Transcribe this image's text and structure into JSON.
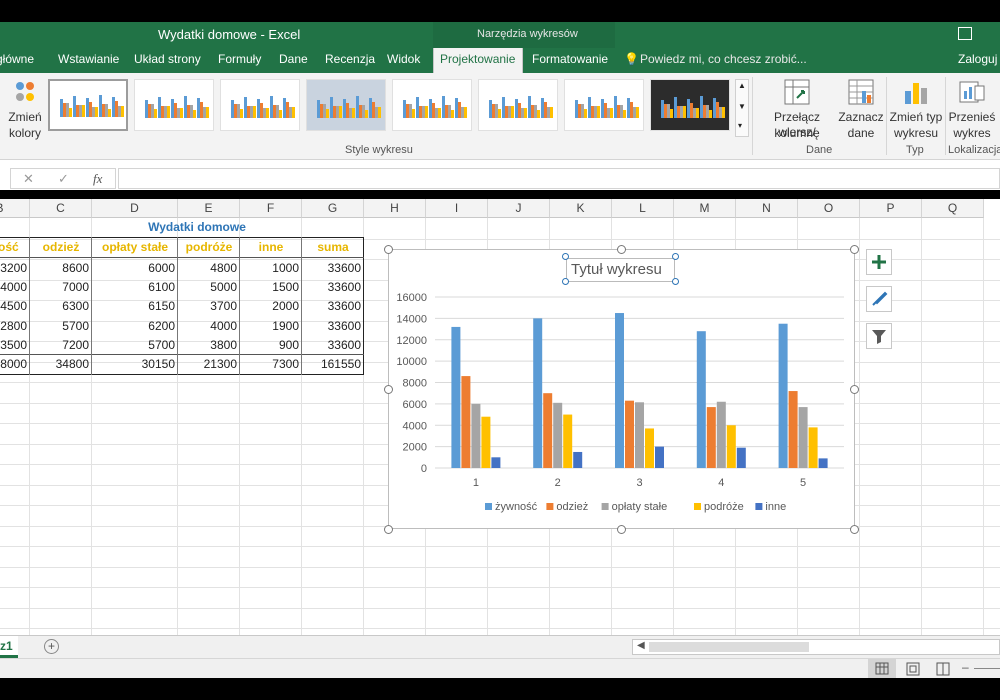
{
  "window": {
    "title": "Wydatki domowe - Excel",
    "context_title": "Narzędzia wykresów",
    "login": "Zaloguj"
  },
  "ribbon_tabs": [
    "główne",
    "Wstawianie",
    "Układ strony",
    "Formuły",
    "Dane",
    "Recenzja",
    "Widok",
    "Projektowanie",
    "Formatowanie"
  ],
  "active_tab": "Projektowanie",
  "tell_me": "Powiedz mi, co chcesz zrobić...",
  "ribbon": {
    "change_colors": [
      "Zmień",
      "kolory"
    ],
    "gallery_label": "Style wykresu",
    "switch_row_col": [
      "Przełącz wiersz/",
      "kolumnę"
    ],
    "select_data": [
      "Zaznacz",
      "dane"
    ],
    "data_group": "Dane",
    "change_type": [
      "Zmień typ",
      "wykresu"
    ],
    "type_group": "Typ",
    "move_chart": [
      "Przenieś",
      "wykres"
    ],
    "location_group": "Lokalizacja"
  },
  "formula_bar": {
    "cancel": "✕",
    "enter": "✓",
    "fx": "fx",
    "content": ""
  },
  "columns": [
    "B",
    "C",
    "D",
    "E",
    "F",
    "G",
    "H",
    "I",
    "J",
    "K",
    "L",
    "M",
    "N",
    "O",
    "P",
    "Q"
  ],
  "table": {
    "title": "Wydatki domowe",
    "headers": [
      "wność",
      "odzież",
      "opłaty stałe",
      "podróże",
      "inne",
      "suma"
    ],
    "rows": [
      [
        "3200",
        "8600",
        "6000",
        "4800",
        "1000",
        "33600"
      ],
      [
        "4000",
        "7000",
        "6100",
        "5000",
        "1500",
        "33600"
      ],
      [
        "4500",
        "6300",
        "6150",
        "3700",
        "2000",
        "33600"
      ],
      [
        "2800",
        "5700",
        "6200",
        "4000",
        "1900",
        "33600"
      ],
      [
        "3500",
        "7200",
        "5700",
        "3800",
        "900",
        "33600"
      ]
    ],
    "totals": [
      "8000",
      "34800",
      "30150",
      "21300",
      "7300",
      "161550"
    ]
  },
  "chart_data": {
    "type": "bar",
    "title": "Tytuł wykresu",
    "categories": [
      "1",
      "2",
      "3",
      "4",
      "5"
    ],
    "ylim": [
      0,
      16000
    ],
    "yticks": [
      0,
      2000,
      4000,
      6000,
      8000,
      10000,
      12000,
      14000,
      16000
    ],
    "grid": true,
    "legend": "bottom",
    "series": [
      {
        "name": "żywność",
        "color": "#5b9bd5",
        "values": [
          13200,
          14000,
          14500,
          12800,
          13500
        ]
      },
      {
        "name": "odzież",
        "color": "#ed7d31",
        "values": [
          8600,
          7000,
          6300,
          5700,
          7200
        ]
      },
      {
        "name": "opłaty stałe",
        "color": "#a5a5a5",
        "values": [
          6000,
          6100,
          6150,
          6200,
          5700
        ]
      },
      {
        "name": "podróże",
        "color": "#ffc000",
        "values": [
          4800,
          5000,
          3700,
          4000,
          3800
        ]
      },
      {
        "name": "inne",
        "color": "#4472c4",
        "values": [
          1000,
          1500,
          2000,
          1900,
          900
        ]
      }
    ]
  },
  "sheet_tab": "z1",
  "colors": {
    "excel_green": "#217346",
    "table_title": "#2e75b6",
    "table_header": "#e7b600"
  }
}
